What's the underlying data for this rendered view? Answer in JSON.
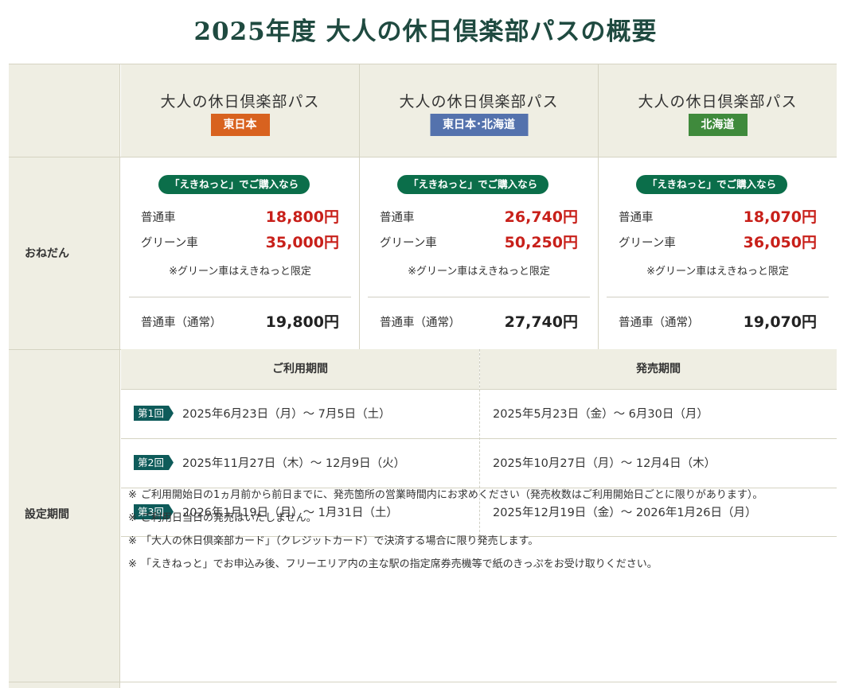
{
  "page": {
    "title": "2025年度 大人の休日倶楽部パスの概要"
  },
  "rows": {
    "price_label": "おねだん",
    "period_label": "設定期間"
  },
  "passes": [
    {
      "name": "大人の休日倶楽部パス",
      "area": "東日本",
      "area_color": "#d8621f",
      "eki_badge": "「えきねっと」でご購入なら",
      "standard_label": "普通車",
      "standard_price": "18,800円",
      "green_label": "グリーン車",
      "green_price": "35,000円",
      "green_note": "※グリーン車はえきねっと限定",
      "regular_label": "普通車（通常）",
      "regular_price": "19,800円"
    },
    {
      "name": "大人の休日倶楽部パス",
      "area": "東日本･北海道",
      "area_color": "#5472ad",
      "eki_badge": "「えきねっと」でご購入なら",
      "standard_label": "普通車",
      "standard_price": "26,740円",
      "green_label": "グリーン車",
      "green_price": "50,250円",
      "green_note": "※グリーン車はえきねっと限定",
      "regular_label": "普通車（通常）",
      "regular_price": "27,740円"
    },
    {
      "name": "大人の休日倶楽部パス",
      "area": "北海道",
      "area_color": "#3f8a3c",
      "eki_badge": "「えきねっと」でご購入なら",
      "standard_label": "普通車",
      "standard_price": "18,070円",
      "green_label": "グリーン車",
      "green_price": "36,050円",
      "green_note": "※グリーン車はえきねっと限定",
      "regular_label": "普通車（通常）",
      "regular_price": "19,070円"
    }
  ],
  "period": {
    "use_header": "ご利用期間",
    "sale_header": "発売期間",
    "rounds": [
      {
        "tag": "第1回",
        "use": "2025年6月23日（月）～ 7月5日（土）",
        "sale": "2025年5月23日（金）～ 6月30日（月）"
      },
      {
        "tag": "第2回",
        "use": "2025年11月27日（木）～ 12月9日（火）",
        "sale": "2025年10月27日（月）～ 12月4日（木）"
      },
      {
        "tag": "第3回",
        "use": "2026年1月19日（月）～ 1月31日（土）",
        "sale": "2025年12月19日（金）～ 2026年1月26日（月）"
      }
    ],
    "notes": [
      {
        "mark": "※",
        "text": "ご利用開始日の1ヵ月前から前日までに、発売箇所の営業時間内にお求めください（発売枚数はご利用開始日ごとに限りがあります）。"
      },
      {
        "mark": "※",
        "text": "ご利用日当日の発売はいたしません。"
      },
      {
        "mark": "※",
        "text": "「大人の休日倶楽部カード」（クレジットカード）で決済する場合に限り発売します。"
      },
      {
        "mark": "※",
        "text": "「えきねっと」でお申込み後、フリーエリア内の主な駅の指定席券売機等で紙のきっぷをお受け取りください。"
      }
    ]
  },
  "colors": {
    "title": "#1f4a40",
    "price_red": "#c8201a",
    "eki_green": "#0b6e4a",
    "round_tag": "#0e5b5a",
    "header_bg": "#efeee3"
  }
}
